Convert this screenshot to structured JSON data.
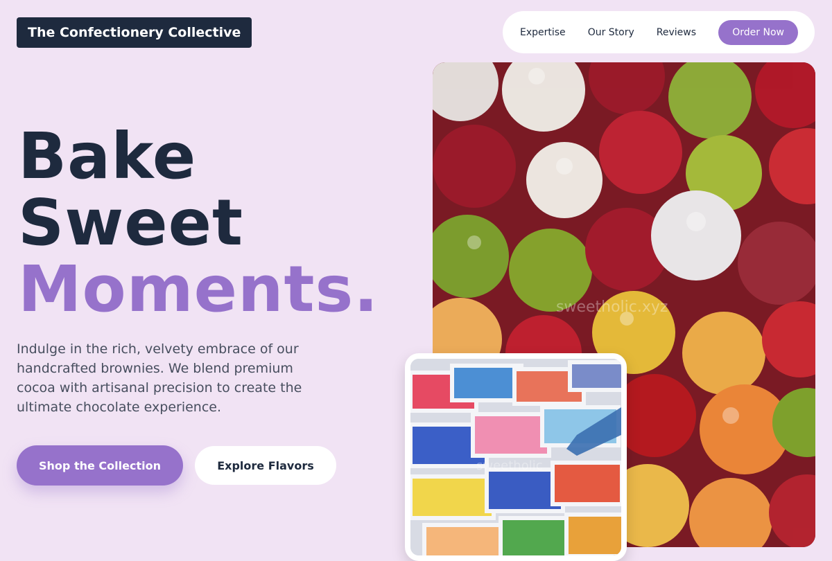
{
  "brand": {
    "name": "The Confectionery Collective"
  },
  "nav": {
    "links": [
      "Expertise",
      "Our Story",
      "Reviews"
    ],
    "cta": "Order Now"
  },
  "hero": {
    "title_line1": "Bake",
    "title_line2": "Sweet",
    "title_line3": "Moments.",
    "description": "Indulge in the rich, velvety embrace of our handcrafted brownies. We blend premium cocoa with artisanal precision to create the ultimate chocolate experience.",
    "primary_cta": "Shop the Collection",
    "secondary_cta": "Explore Flavors"
  },
  "images": {
    "main_watermark": "sweetholic.xyz",
    "small_watermark": "sweetholic"
  },
  "colors": {
    "background": "#f1e3f4",
    "accent": "#9672cb",
    "dark": "#1e2a3e"
  }
}
